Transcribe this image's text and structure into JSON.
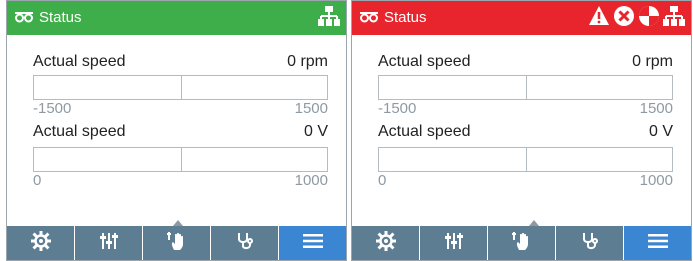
{
  "panels": [
    {
      "state": "ok",
      "header": {
        "title": "Status",
        "color": "#3dae49",
        "icons": [
          "glasses-icon",
          "network-icon"
        ]
      },
      "meters": [
        {
          "label": "Actual speed",
          "value": "0 rpm",
          "min": "-1500",
          "max": "1500",
          "min_value": -1500,
          "max_value": 1500,
          "current": 0
        },
        {
          "label": "Actual speed",
          "value": "0 V",
          "min": "0",
          "max": "1000",
          "min_value": 0,
          "max_value": 1000,
          "current": 0
        }
      ],
      "nav": {
        "items": [
          "gear-icon",
          "sliders-icon",
          "hand-control-icon",
          "stethoscope-icon",
          "menu-icon"
        ],
        "selected": "hand-control-icon"
      }
    },
    {
      "state": "fault",
      "header": {
        "title": "Status",
        "color": "#e8252c",
        "icons": [
          "glasses-icon",
          "warning-icon",
          "error-x-icon",
          "maintenance-icon",
          "network-icon"
        ]
      },
      "meters": [
        {
          "label": "Actual speed",
          "value": "0 rpm",
          "min": "-1500",
          "max": "1500",
          "min_value": -1500,
          "max_value": 1500,
          "current": 0
        },
        {
          "label": "Actual speed",
          "value": "0 V",
          "min": "0",
          "max": "1000",
          "min_value": 0,
          "max_value": 1000,
          "current": 0
        }
      ],
      "nav": {
        "items": [
          "gear-icon",
          "sliders-icon",
          "hand-control-icon",
          "stethoscope-icon",
          "menu-icon"
        ],
        "selected": "hand-control-icon"
      }
    }
  ],
  "colors": {
    "nav_background": "#5d7d92",
    "nav_active": "#3a86d3",
    "text": "#222222",
    "scale_text": "#8e9aa3",
    "bar_border": "#b4bcc2"
  }
}
